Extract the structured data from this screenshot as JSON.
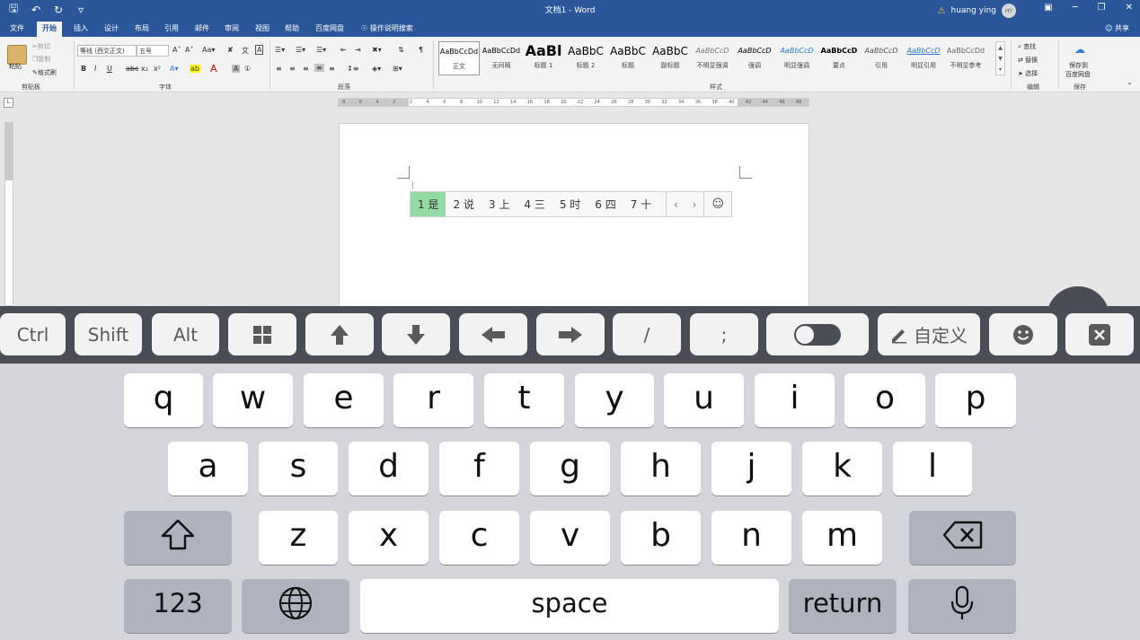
{
  "titlebar": {
    "title": "文档1 - Word",
    "user": "huang ying",
    "avatar": "HY"
  },
  "tabs": [
    "文件",
    "开始",
    "插入",
    "设计",
    "布局",
    "引用",
    "邮件",
    "审阅",
    "视图",
    "帮助",
    "百度网盘"
  ],
  "active_tab": "开始",
  "tell_me": "操作说明搜索",
  "share": "共享",
  "clipboard": {
    "paste": "粘贴",
    "cut": "剪切",
    "copy": "复制",
    "format_painter": "格式刷",
    "label": "剪贴板"
  },
  "font": {
    "name": "等线 (西文正文)",
    "size": "五号",
    "label": "字体"
  },
  "paragraph": {
    "label": "段落"
  },
  "styles": {
    "label": "样式",
    "items": [
      {
        "preview": "AaBbCcDd",
        "name": "正文"
      },
      {
        "preview": "AaBbCcDd",
        "name": "无间隔"
      },
      {
        "preview": "AaBl",
        "name": "标题 1"
      },
      {
        "preview": "AaBbC",
        "name": "标题 2"
      },
      {
        "preview": "AaBbC",
        "name": "标题"
      },
      {
        "preview": "AaBbC",
        "name": "副标题"
      },
      {
        "preview": "AaBbCcD",
        "name": "不明显强调"
      },
      {
        "preview": "AaBbCcD",
        "name": "强调"
      },
      {
        "preview": "AaBbCcD",
        "name": "明显强调"
      },
      {
        "preview": "AaBbCcD",
        "name": "要点"
      },
      {
        "preview": "AaBbCcD",
        "name": "引用"
      },
      {
        "preview": "AaBbCcD",
        "name": "明显引用"
      },
      {
        "preview": "AaBbCcDd",
        "name": "不明显参考"
      }
    ]
  },
  "editing": {
    "find": "查找",
    "replace": "替换",
    "select": "选择",
    "label": "编辑"
  },
  "save_group": {
    "button_line1": "保存到",
    "button_line2": "百度网盘",
    "label": "保存"
  },
  "ruler_ticks": [
    "8",
    "6",
    "4",
    "2",
    "2",
    "4",
    "6",
    "8",
    "10",
    "12",
    "14",
    "16",
    "18",
    "20",
    "22",
    "24",
    "26",
    "28",
    "30",
    "32",
    "34",
    "36",
    "38",
    "40",
    "42",
    "44",
    "46",
    "48"
  ],
  "ime_candidates": [
    "1 是",
    "2 说",
    "3 上",
    "4 三",
    "5 时",
    "6 四",
    "7 十"
  ],
  "keyboard_toolbar": {
    "ctrl": "Ctrl",
    "shift": "Shift",
    "alt": "Alt",
    "slash": "/",
    "semicolon": ";",
    "custom": "自定义"
  },
  "keyboard": {
    "row1": [
      "q",
      "w",
      "e",
      "r",
      "t",
      "y",
      "u",
      "i",
      "o",
      "p"
    ],
    "row2": [
      "a",
      "s",
      "d",
      "f",
      "g",
      "h",
      "j",
      "k",
      "l"
    ],
    "row3": [
      "z",
      "x",
      "c",
      "v",
      "b",
      "n",
      "m"
    ],
    "numbers": "123",
    "space": "space",
    "return": "return"
  },
  "colors": {
    "word_blue": "#2b579a",
    "candidate_highlight": "#93dba5",
    "keyboard_bg": "#d3d5db",
    "toolbar_bg": "#4a4d55"
  }
}
